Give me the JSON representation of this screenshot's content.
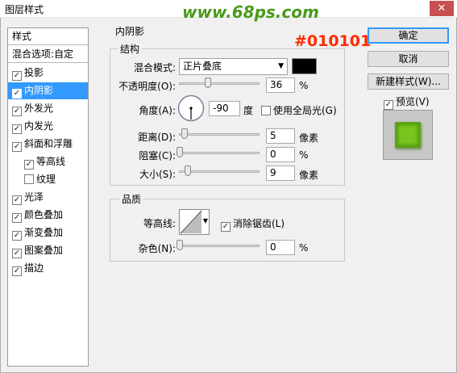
{
  "window": {
    "title": "图层样式",
    "watermark": "www.68ps.com",
    "close": "✕"
  },
  "annotation": "#010101",
  "colors": {
    "shadow_color": "#010101",
    "watermark": "#4a9a1a",
    "annotation": "#ff2a00",
    "selection": "#3399ff"
  },
  "sidebar": {
    "header": "样式",
    "blend_options": "混合选项:自定",
    "items": [
      {
        "label": "投影",
        "checked": true
      },
      {
        "label": "内阴影",
        "checked": true
      },
      {
        "label": "外发光",
        "checked": true
      },
      {
        "label": "内发光",
        "checked": true
      },
      {
        "label": "斜面和浮雕",
        "checked": true
      },
      {
        "label": "等高线",
        "checked": true
      },
      {
        "label": "纹理",
        "checked": false
      },
      {
        "label": "光泽",
        "checked": true
      },
      {
        "label": "颜色叠加",
        "checked": true
      },
      {
        "label": "渐变叠加",
        "checked": true
      },
      {
        "label": "图案叠加",
        "checked": true
      },
      {
        "label": "描边",
        "checked": true
      }
    ]
  },
  "panel": {
    "title": "内阴影",
    "structure": {
      "title": "结构",
      "blend_mode_label": "混合模式:",
      "blend_mode_value": "正片叠底",
      "opacity_label": "不透明度(O):",
      "opacity_value": "36",
      "opacity_unit": "%",
      "angle_label": "角度(A):",
      "angle_value": "-90",
      "angle_unit": "度",
      "global_light_label": "使用全局光(G)",
      "global_light_checked": false,
      "distance_label": "距离(D):",
      "distance_value": "5",
      "distance_unit": "像素",
      "choke_label": "阻塞(C):",
      "choke_value": "0",
      "choke_unit": "%",
      "size_label": "大小(S):",
      "size_value": "9",
      "size_unit": "像素"
    },
    "quality": {
      "title": "品质",
      "contour_label": "等高线:",
      "antialias_label": "消除锯齿(L)",
      "antialias_checked": true,
      "noise_label": "杂色(N):",
      "noise_value": "0",
      "noise_unit": "%"
    }
  },
  "buttons": {
    "ok": "确定",
    "cancel": "取消",
    "new_style": "新建样式(W)...",
    "preview": "预览(V)",
    "preview_checked": true
  }
}
